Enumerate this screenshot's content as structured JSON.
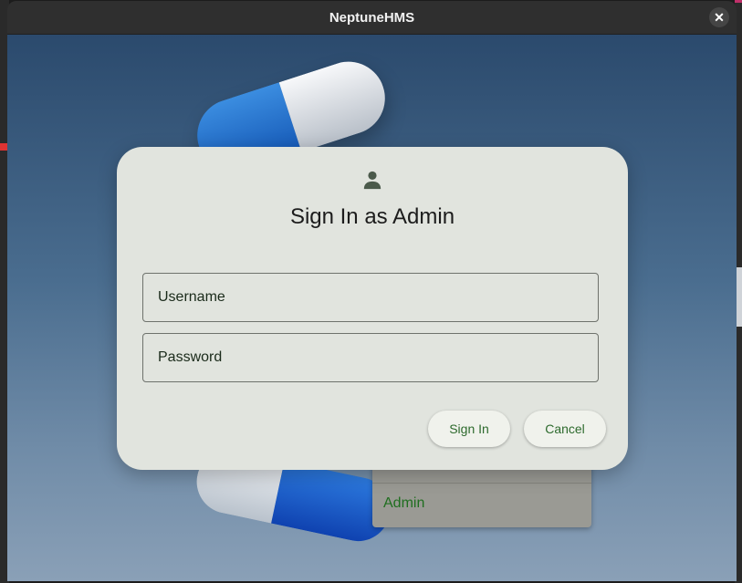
{
  "window": {
    "title": "NeptuneHMS",
    "close_label": "✕"
  },
  "background_menu": {
    "item": "Admin"
  },
  "dialog": {
    "icon": "person-icon",
    "title": "Sign In as Admin",
    "username_placeholder": "Username",
    "username_value": "",
    "password_placeholder": "Password",
    "password_value": "",
    "signin_label": "Sign In",
    "cancel_label": "Cancel"
  },
  "colors": {
    "accent_text": "#2d6a2d",
    "dialog_bg": "#e1e4de"
  }
}
